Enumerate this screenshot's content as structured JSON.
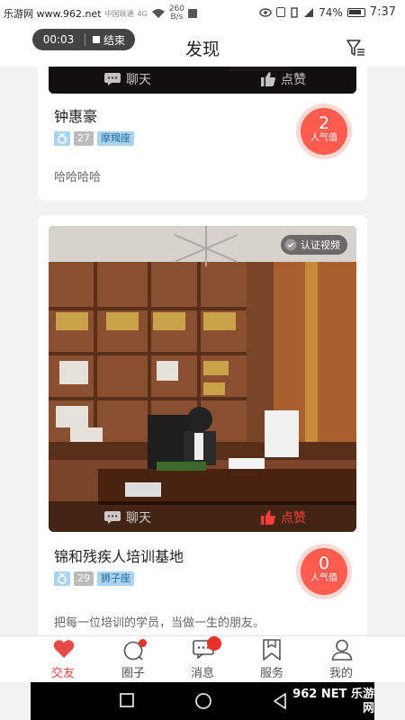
{
  "status_bar": {
    "watermark": "乐游网 www.962.net",
    "carrier": "中国联通",
    "signal": "4G",
    "net_speed_value": "260",
    "net_speed_unit": "B/s",
    "battery": "74%",
    "time": "7:37"
  },
  "header": {
    "title": "发现",
    "call_timer": "00:03",
    "end_call_label": "结束"
  },
  "cards": [
    {
      "chat_label": "聊天",
      "like_label": "点赞",
      "name": "钟惠豪",
      "age": "27",
      "zodiac": "摩羯座",
      "bio": "哈哈哈哈",
      "popularity_value": "2",
      "popularity_label": "人气值"
    },
    {
      "verified_label": "认证视频",
      "chat_label": "聊天",
      "like_label": "点赞",
      "name": "锦和残疾人培训基地",
      "age": "29",
      "zodiac": "狮子座",
      "bio": "把每一位培训的学员，当做一生的朋友。",
      "popularity_value": "0",
      "popularity_label": "人气值"
    }
  ],
  "tabbar": {
    "tabs": [
      {
        "label": "交友",
        "icon": "heart-icon",
        "active": true
      },
      {
        "label": "圈子",
        "icon": "circle-icon",
        "badge": true
      },
      {
        "label": "消息",
        "icon": "message-icon",
        "badge": true
      },
      {
        "label": "服务",
        "icon": "bookmark-icon"
      },
      {
        "label": "我的",
        "icon": "person-icon"
      }
    ]
  },
  "overlay_watermark": "962 NET 乐游网",
  "colors": {
    "accent": "#e84a4a",
    "popularity": "#ff5c50",
    "tag_blue": "#a8d4f2"
  }
}
